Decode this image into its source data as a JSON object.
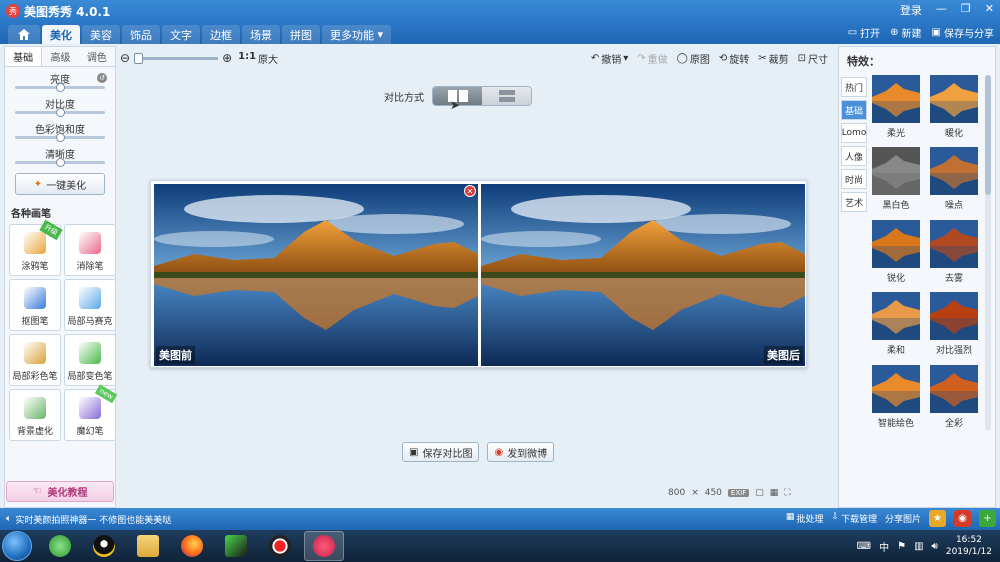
{
  "app": {
    "title": "美图秀秀 4.0.1",
    "logo": "秀"
  },
  "window": {
    "login": "登录",
    "minimize": "—",
    "restore": "❐",
    "close": "✕"
  },
  "menu": {
    "home_icon": "home-icon",
    "tabs": [
      "美化",
      "美容",
      "饰品",
      "文字",
      "边框",
      "场景",
      "拼图",
      "更多功能"
    ],
    "right": {
      "open": "打开",
      "new": "新建",
      "save": "保存与分享"
    }
  },
  "left": {
    "tabs": [
      "基础",
      "高级",
      "调色"
    ],
    "sliders": [
      {
        "label": "亮度",
        "value": 0.5
      },
      {
        "label": "对比度",
        "value": 0.5
      },
      {
        "label": "色彩饱和度",
        "value": 0.5
      },
      {
        "label": "清晰度",
        "value": 0.5
      }
    ],
    "beautify_btn": "一键美化",
    "brushes_title": "各种画笔",
    "brushes": [
      {
        "label": "涂鸦笔",
        "badge": "升级",
        "color": "#e9a53a"
      },
      {
        "label": "消除笔",
        "badge": "",
        "color": "#e86a8a"
      },
      {
        "label": "抠图笔",
        "badge": "",
        "color": "#3a7ad8"
      },
      {
        "label": "局部马赛克",
        "badge": "",
        "color": "#5aa8e8"
      },
      {
        "label": "局部彩色笔",
        "badge": "",
        "color": "#d8a23a"
      },
      {
        "label": "局部变色笔",
        "badge": "",
        "color": "#4ab84a"
      },
      {
        "label": "背景虚化",
        "badge": "",
        "color": "#6ab36a"
      },
      {
        "label": "魔幻笔",
        "badge": "new",
        "color": "#8a6ad8"
      }
    ],
    "tutorial": "美化教程"
  },
  "toolbar": {
    "zoom_ratio": "1:1",
    "zoom_label": "原大",
    "undo": "撤销",
    "redo": "重做",
    "original": "原图",
    "rotate": "旋转",
    "crop": "裁剪",
    "size": "尺寸"
  },
  "compare": {
    "label": "对比方式"
  },
  "photos": {
    "before": "美图前",
    "after": "美图后"
  },
  "actions": {
    "save_compare": "保存对比图",
    "share_weibo": "发到微博"
  },
  "image_info": {
    "width": "800",
    "sep": "×",
    "height": "450",
    "exif": "EXIF"
  },
  "right": {
    "title": "特效：",
    "vtabs": [
      "热门",
      "基础",
      "Lomo",
      "人像",
      "时尚",
      "艺术"
    ],
    "effects": [
      {
        "label": "柔光",
        "tone": "#e88a2a"
      },
      {
        "label": "暖化",
        "tone": "#f0a040"
      },
      {
        "label": "黑白色",
        "tone": "#888888"
      },
      {
        "label": "噪点",
        "tone": "#c07030"
      },
      {
        "label": "锐化",
        "tone": "#d8781a"
      },
      {
        "label": "去雾",
        "tone": "#b04820"
      },
      {
        "label": "柔和",
        "tone": "#e89a4a"
      },
      {
        "label": "对比强烈",
        "tone": "#b84010"
      },
      {
        "label": "智能绘色",
        "tone": "#e88a2a"
      },
      {
        "label": "全彩",
        "tone": "#d06020"
      }
    ]
  },
  "statusbar": {
    "message": "实时美颜拍照神器一 不修图也能美美哒",
    "batch": "批处理",
    "download": "下载管理",
    "share_pic": "分享图片"
  },
  "taskbar": {
    "time": "16:52",
    "date": "2019/1/12",
    "ime": "中"
  }
}
